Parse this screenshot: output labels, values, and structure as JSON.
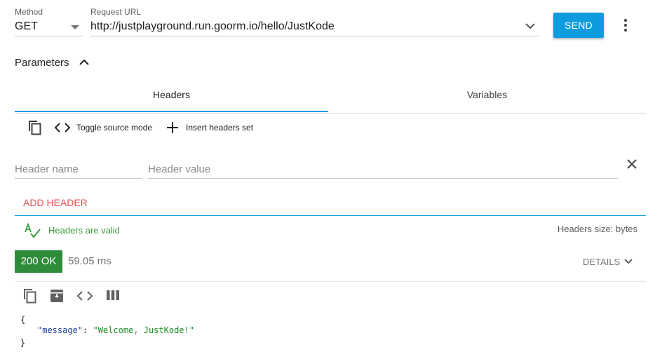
{
  "request": {
    "method_label": "Method",
    "method_value": "GET",
    "url_label": "Request URL",
    "url_value": "http://justplayground.run.goorm.io/hello/JustKode",
    "send_label": "SEND"
  },
  "parameters": {
    "title": "Parameters",
    "tabs": [
      {
        "label": "Headers",
        "active": true
      },
      {
        "label": "Variables",
        "active": false
      }
    ]
  },
  "headers_toolbar": {
    "toggle_source_label": "Toggle source mode",
    "insert_set_label": "Insert headers set"
  },
  "header_row": {
    "name_placeholder": "Header name",
    "value_placeholder": "Header value"
  },
  "add_header_label": "ADD HEADER",
  "validation": {
    "status_text": "Headers are valid",
    "size_text": "Headers size: bytes"
  },
  "response": {
    "status_badge": "200 OK",
    "time": "59.05 ms",
    "details_label": "DETAILS",
    "body_open": "{",
    "body_key": "\"message\"",
    "body_colon": ": ",
    "body_value": "\"Welcome, JustKode!\"",
    "body_close": "}"
  },
  "colors": {
    "accent_blue": "#0e9be0",
    "status_green": "#2e8b3a",
    "valid_green": "#3b9a3b",
    "add_header_red": "#e0524f",
    "json_key": "#1f3fa0",
    "json_string": "#1a8f24"
  }
}
